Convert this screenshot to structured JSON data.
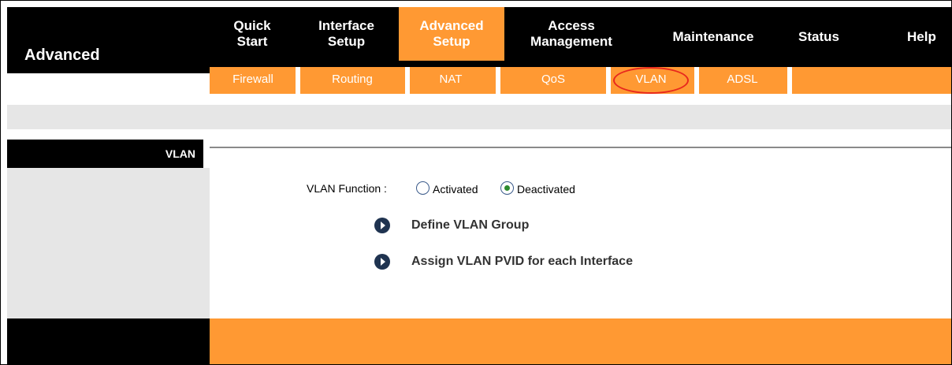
{
  "brand": {
    "title": "Advanced"
  },
  "top_nav": [
    {
      "line1": "Quick",
      "line2": "Start"
    },
    {
      "line1": "Interface",
      "line2": "Setup"
    },
    {
      "line1": "Advanced",
      "line2": "Setup",
      "active": true
    },
    {
      "line1": "Access",
      "line2": "Management"
    },
    {
      "line1": "Maintenance"
    },
    {
      "line1": "Status"
    },
    {
      "line1": "Help"
    }
  ],
  "sub_nav": [
    "Firewall",
    "Routing",
    "NAT",
    "QoS",
    "VLAN",
    "ADSL"
  ],
  "sub_nav_active": "VLAN",
  "section": {
    "title": "VLAN"
  },
  "vlan_function": {
    "label": "VLAN Function :",
    "options": [
      "Activated",
      "Deactivated"
    ],
    "selected": "Deactivated"
  },
  "links": [
    "Define VLAN Group",
    "Assign VLAN PVID for each Interface"
  ],
  "colors": {
    "accent": "#ff9933",
    "bar": "#000000",
    "panel": "#e6e6e6",
    "highlight": "#e8281d"
  },
  "icons": {
    "link_bullet": "circle-arrow-icon"
  }
}
